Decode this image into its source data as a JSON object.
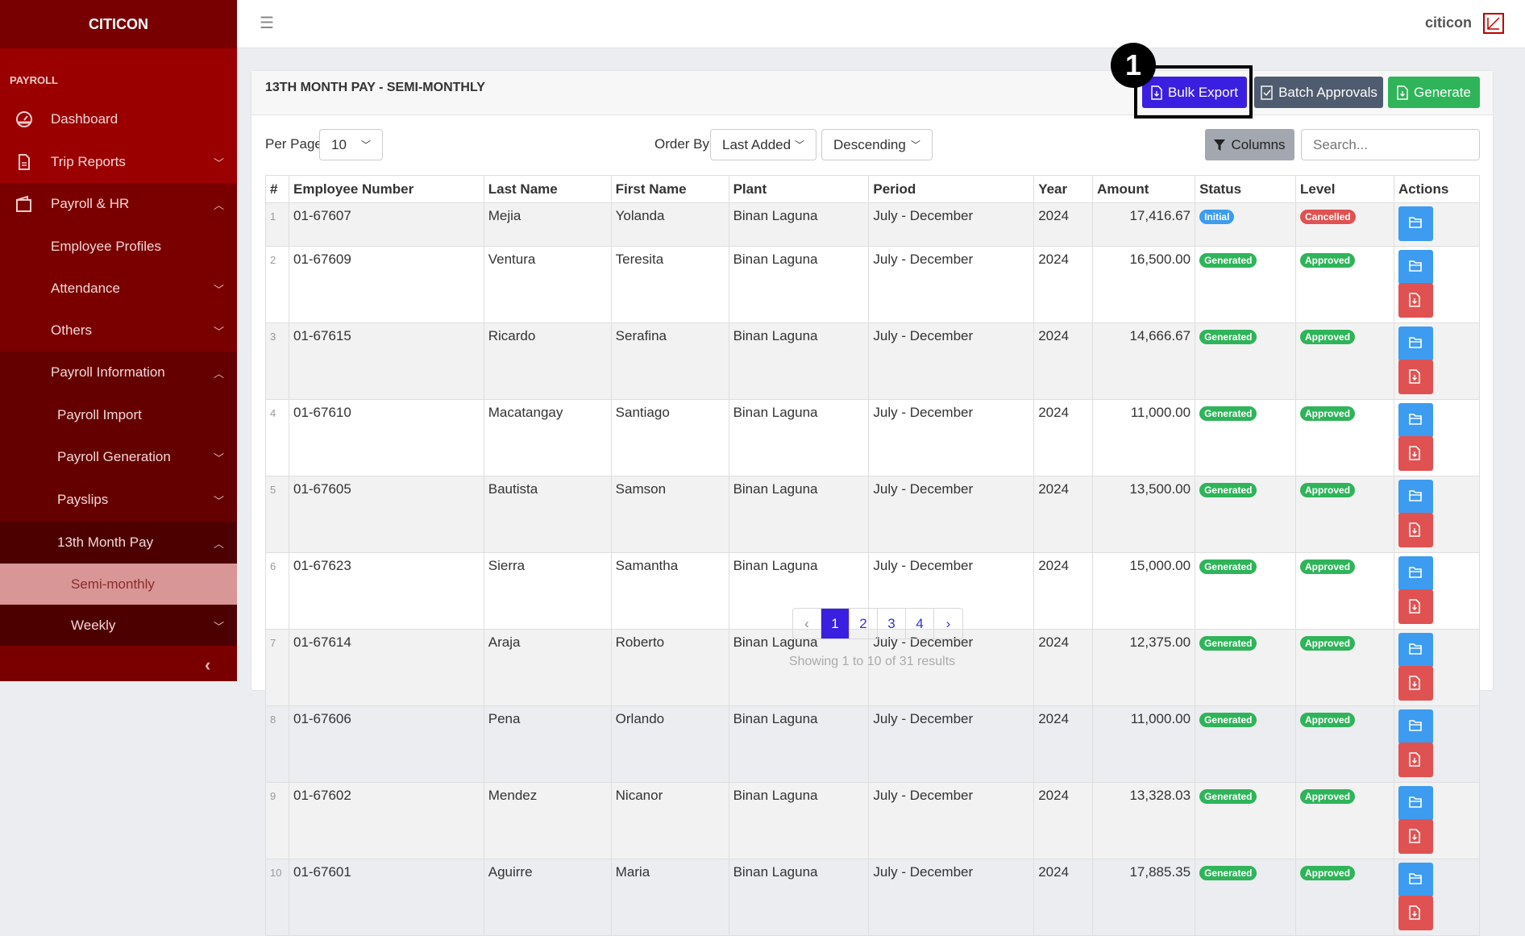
{
  "brand": "CITICON",
  "sidebar": {
    "section": "PAYROLL",
    "items": [
      {
        "label": "Dashboard"
      },
      {
        "label": "Trip Reports"
      },
      {
        "label": "Payroll & HR"
      },
      {
        "label": "Employee Profiles"
      },
      {
        "label": "Attendance"
      },
      {
        "label": "Others"
      },
      {
        "label": "Payroll Information"
      },
      {
        "label": "Payroll Import"
      },
      {
        "label": "Payroll Generation"
      },
      {
        "label": "Payslips"
      },
      {
        "label": "13th Month Pay"
      },
      {
        "label": "Semi-monthly"
      },
      {
        "label": "Weekly"
      }
    ]
  },
  "header": {
    "user": "citicon"
  },
  "page": {
    "title": "13TH MONTH PAY - SEMI-MONTHLY",
    "annotation": "1",
    "buttons": {
      "bulk_export": "Bulk Export",
      "batch_approvals": "Batch Approvals",
      "generate": "Generate",
      "columns": "Columns"
    },
    "per_page_label": "Per Page",
    "per_page": "10",
    "order_by_label": "Order By",
    "order_by": "Last Added",
    "direction": "Descending",
    "search_placeholder": "Search..."
  },
  "table": {
    "headers": [
      "#",
      "Employee Number",
      "Last Name",
      "First Name",
      "Plant",
      "Period",
      "Year",
      "Amount",
      "Status",
      "Level",
      "Actions"
    ],
    "rows": [
      [
        "1",
        "01-67607",
        "Mejia",
        "Yolanda",
        "Binan Laguna",
        "July - December",
        "2024",
        "17,416.67",
        "Initial",
        "Cancelled"
      ],
      [
        "2",
        "01-67609",
        "Ventura",
        "Teresita",
        "Binan Laguna",
        "July - December",
        "2024",
        "16,500.00",
        "Generated",
        "Approved"
      ],
      [
        "3",
        "01-67615",
        "Ricardo",
        "Serafina",
        "Binan Laguna",
        "July - December",
        "2024",
        "14,666.67",
        "Generated",
        "Approved"
      ],
      [
        "4",
        "01-67610",
        "Macatangay",
        "Santiago",
        "Binan Laguna",
        "July - December",
        "2024",
        "11,000.00",
        "Generated",
        "Approved"
      ],
      [
        "5",
        "01-67605",
        "Bautista",
        "Samson",
        "Binan Laguna",
        "July - December",
        "2024",
        "13,500.00",
        "Generated",
        "Approved"
      ],
      [
        "6",
        "01-67623",
        "Sierra",
        "Samantha",
        "Binan Laguna",
        "July - December",
        "2024",
        "15,000.00",
        "Generated",
        "Approved"
      ],
      [
        "7",
        "01-67614",
        "Araja",
        "Roberto",
        "Binan Laguna",
        "July - December",
        "2024",
        "12,375.00",
        "Generated",
        "Approved"
      ],
      [
        "8",
        "01-67606",
        "Pena",
        "Orlando",
        "Binan Laguna",
        "July - December",
        "2024",
        "11,000.00",
        "Generated",
        "Approved"
      ],
      [
        "9",
        "01-67602",
        "Mendez",
        "Nicanor",
        "Binan Laguna",
        "July - December",
        "2024",
        "13,328.03",
        "Generated",
        "Approved"
      ],
      [
        "10",
        "01-67601",
        "Aguirre",
        "Maria",
        "Binan Laguna",
        "July - December",
        "2024",
        "17,885.35",
        "Generated",
        "Approved"
      ]
    ]
  },
  "pagination": {
    "prev": "‹",
    "pages": [
      "1",
      "2",
      "3",
      "4"
    ],
    "next": "›",
    "current": "1",
    "summary": "Showing 1 to 10 of 31 results"
  },
  "colors": {
    "initial": "#3d9cf0",
    "cancelled": "#e05252",
    "generated": "#2fb45a",
    "approved": "#2fb45a",
    "primary": "#3a1fe0"
  }
}
